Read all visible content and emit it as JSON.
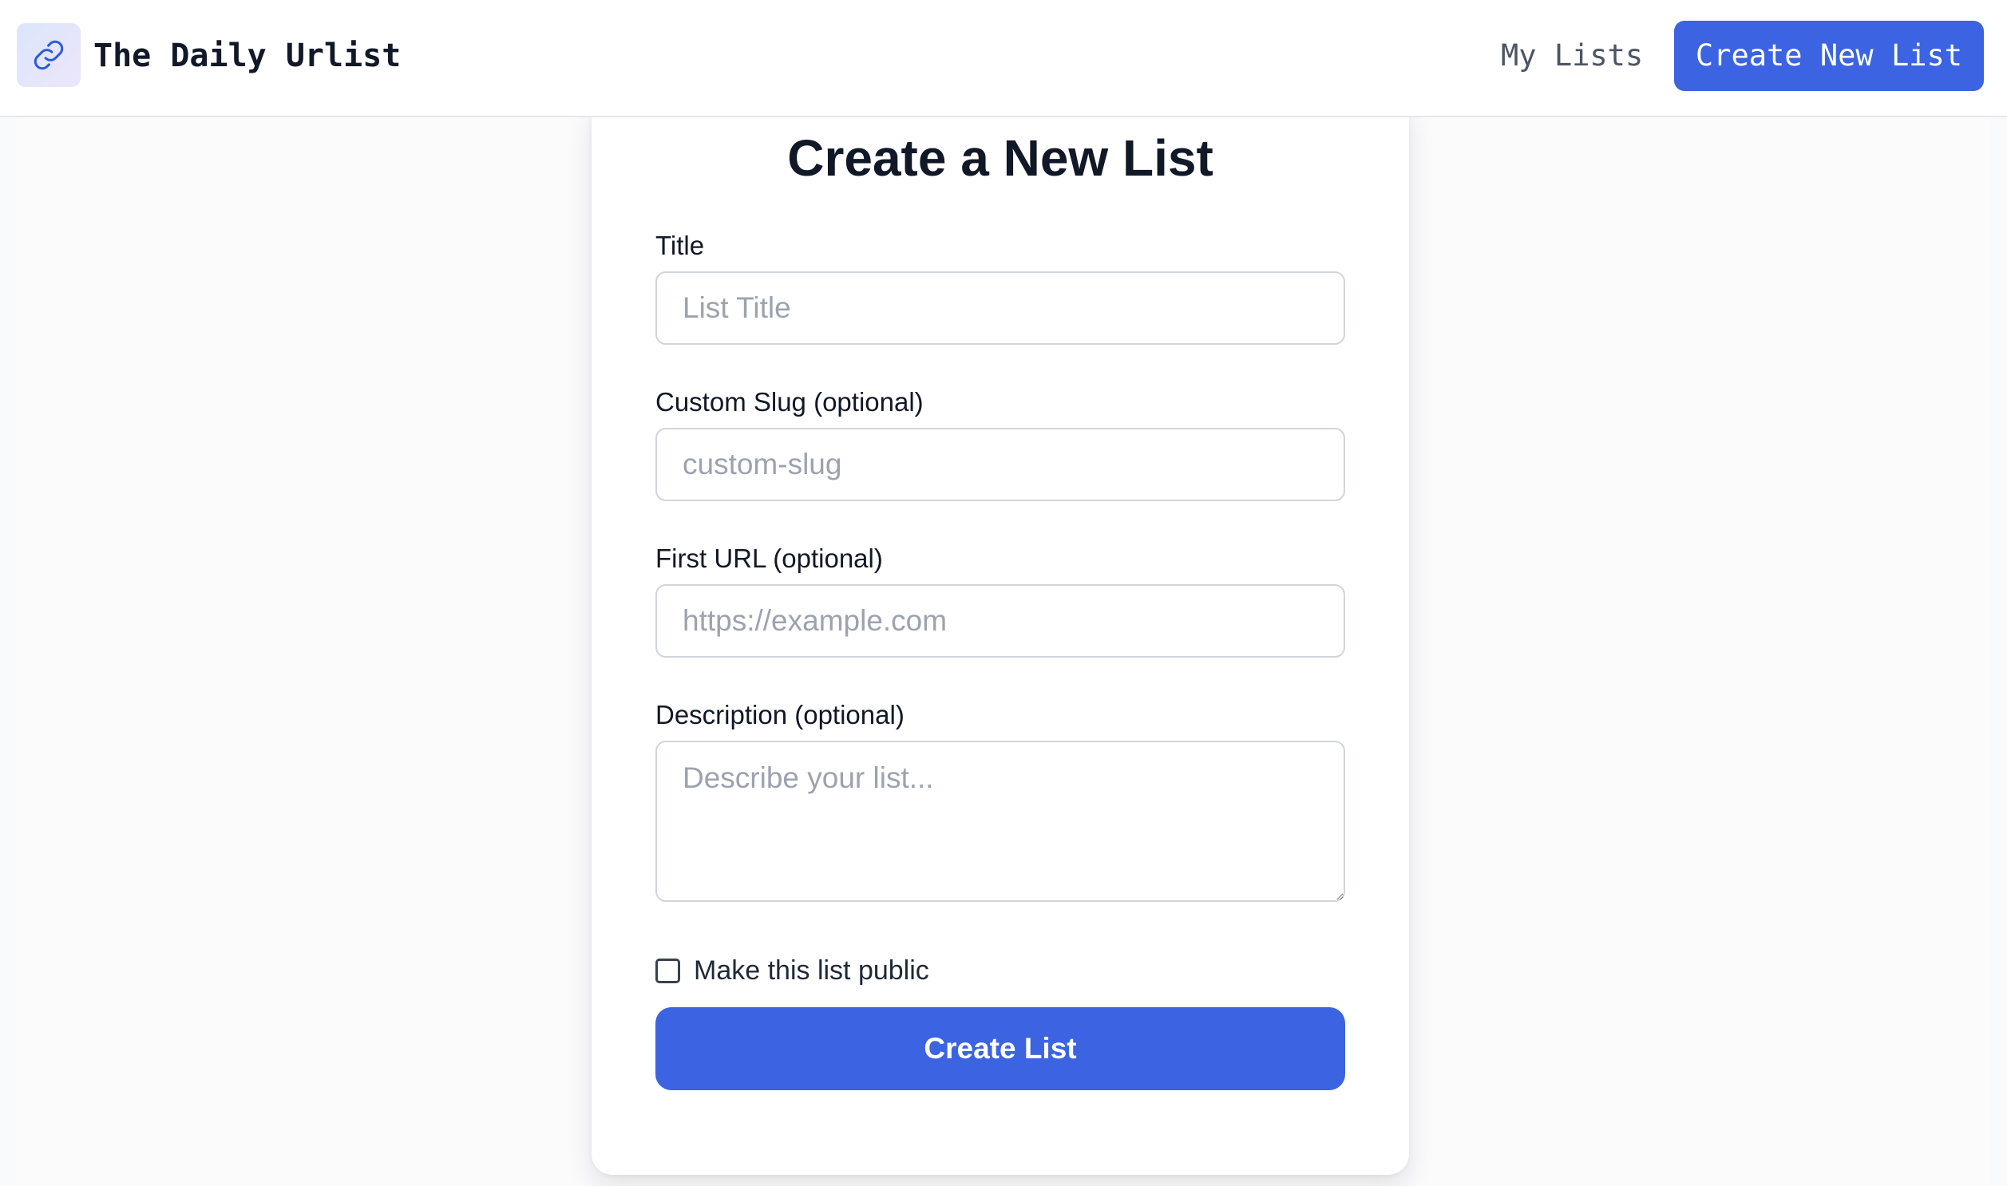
{
  "header": {
    "brand": "The Daily Urlist",
    "logo_icon": "link-icon",
    "nav_my_lists": "My Lists",
    "nav_create": "Create New List"
  },
  "form": {
    "heading": "Create a New List",
    "title_label": "Title",
    "title_placeholder": "List Title",
    "title_value": "",
    "slug_label": "Custom Slug (optional)",
    "slug_placeholder": "custom-slug",
    "slug_value": "",
    "url_label": "First URL (optional)",
    "url_placeholder": "https://example.com",
    "url_value": "",
    "description_label": "Description (optional)",
    "description_placeholder": "Describe your list...",
    "description_value": "",
    "public_label": "Make this list public",
    "public_checked": false,
    "submit_label": "Create List"
  },
  "colors": {
    "accent": "#3b63e2",
    "text": "#111827",
    "muted": "#4b5563",
    "placeholder": "#9ca3af",
    "border": "#d1d5db",
    "background": "#f9fafb"
  }
}
